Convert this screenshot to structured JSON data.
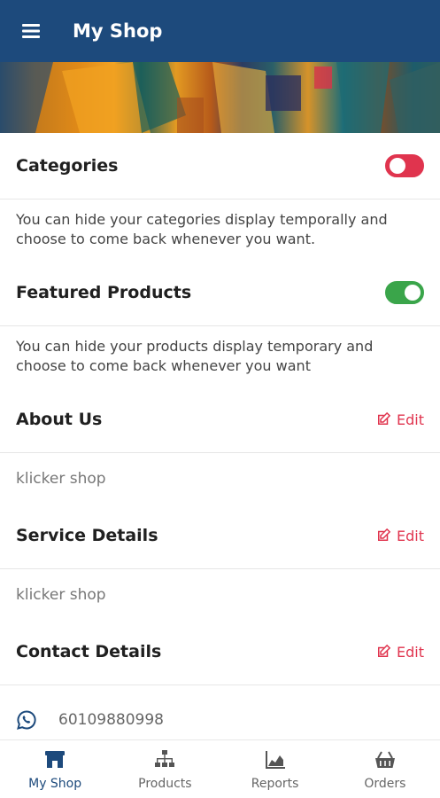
{
  "app": {
    "title": "My Shop"
  },
  "sections": {
    "categories": {
      "title": "Categories",
      "enabled": false,
      "description": "You can hide your categories display temporally and choose to come back whenever you want."
    },
    "featured": {
      "title": "Featured Products",
      "enabled": true,
      "description": "You can hide your products display temporary and choose to come back whenever you want"
    },
    "about": {
      "title": "About Us",
      "edit_label": "Edit",
      "value": "klicker shop"
    },
    "service": {
      "title": "Service Details",
      "edit_label": "Edit",
      "value": "klicker shop"
    },
    "contact": {
      "title": "Contact Details",
      "edit_label": "Edit",
      "phone": "60109880998"
    }
  },
  "nav": {
    "items": [
      {
        "label": "My Shop",
        "icon": "shop-icon",
        "active": true
      },
      {
        "label": "Products",
        "icon": "sitemap-icon",
        "active": false
      },
      {
        "label": "Reports",
        "icon": "chart-icon",
        "active": false
      },
      {
        "label": "Orders",
        "icon": "basket-icon",
        "active": false
      }
    ]
  },
  "colors": {
    "primary": "#1d4a7c",
    "accent_red": "#e0344e",
    "toggle_on": "#3aa54a"
  }
}
